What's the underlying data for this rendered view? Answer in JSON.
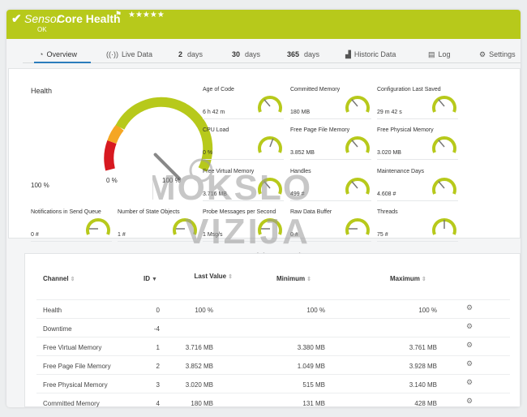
{
  "header": {
    "title_prefix": "Sensor",
    "title": "Core Health",
    "stars": "★★★★★",
    "status": "OK",
    "check_icon": "check-icon",
    "flag_icon": "flag-icon",
    "color": "#b7c91b"
  },
  "tabs": [
    {
      "label": "Overview",
      "icon": "overview-icon"
    },
    {
      "label": "Live Data",
      "icon": "live-data-icon"
    },
    {
      "num": "2",
      "label": "days"
    },
    {
      "num": "30",
      "label": "days"
    },
    {
      "num": "365",
      "label": "days"
    },
    {
      "label": "Historic Data",
      "icon": "historic-data-icon"
    },
    {
      "label": "Log",
      "icon": "log-icon"
    },
    {
      "label": "Settings",
      "icon": "settings-icon"
    }
  ],
  "health": {
    "label": "Health",
    "value": "100 %",
    "min_label": "0 %",
    "max_label": "100 %",
    "level": 1.0
  },
  "gauges": [
    {
      "label": "Age of Code",
      "value": "6 h 42 m"
    },
    {
      "label": "Committed Memory",
      "value": "180 MB"
    },
    {
      "label": "Configuration Last Saved",
      "value": "29 m 42 s"
    },
    {
      "label": "CPU Load",
      "value": "0 %"
    },
    {
      "label": "Free Page File Memory",
      "value": "3.852 MB"
    },
    {
      "label": "Free Physical Memory",
      "value": "3.020 MB"
    },
    {
      "label": "Free Virtual Memory",
      "value": "3.716 MB"
    },
    {
      "label": "Handles",
      "value": "499 #"
    },
    {
      "label": "Maintenance Days",
      "value": "4.608 #"
    },
    {
      "label": "Notifications in Send Queue",
      "value": "0 #"
    },
    {
      "label": "Number of State Objects",
      "value": "1 #"
    },
    {
      "label": "Probe Messages per Second",
      "value": "1 Msg/s"
    },
    {
      "label": "Raw Data Buffer",
      "value": "0 #"
    },
    {
      "label": "Threads",
      "value": "75 #"
    }
  ],
  "table": {
    "headers": {
      "channel": "Channel",
      "id": "ID",
      "last_value": "Last Value",
      "minimum": "Minimum",
      "maximum": "Maximum"
    },
    "rows": [
      {
        "channel": "Health",
        "id": "0",
        "last": "100 %",
        "min": "100 %",
        "max": "100 %"
      },
      {
        "channel": "Downtime",
        "id": "-4",
        "last": "",
        "min": "",
        "max": ""
      },
      {
        "channel": "Free Virtual Memory",
        "id": "1",
        "last": "3.716 MB",
        "min": "3.380 MB",
        "max": "3.761 MB"
      },
      {
        "channel": "Free Page File Memory",
        "id": "2",
        "last": "3.852 MB",
        "min": "1.049 MB",
        "max": "3.928 MB"
      },
      {
        "channel": "Free Physical Memory",
        "id": "3",
        "last": "3.020 MB",
        "min": "515 MB",
        "max": "3.140 MB"
      },
      {
        "channel": "Committed Memory",
        "id": "4",
        "last": "180 MB",
        "min": "131 MB",
        "max": "428 MB"
      }
    ]
  },
  "watermark": {
    "line1": "MOKSLO",
    "line2": "VIZIJA",
    "line3": "powered by esolo"
  }
}
